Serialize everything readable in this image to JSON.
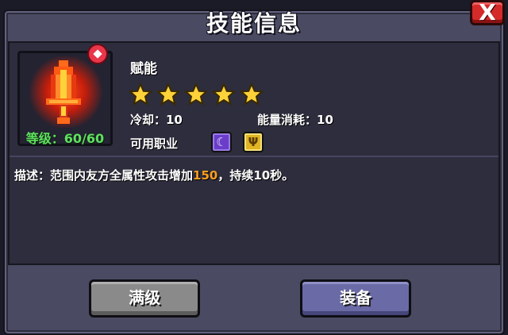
{
  "dialog": {
    "title": "技能信息",
    "close_label": "X"
  },
  "skill": {
    "name": "赋能",
    "icon": "flaming-sword-icon",
    "level_text": "等级：60/60",
    "stars": 5,
    "cooldown_text": "冷却：10",
    "energy_cost_text": "能量消耗：10",
    "classes_label": "可用职业",
    "classes": [
      {
        "icon": "mage-hat-icon",
        "color": "#6b3ec9"
      },
      {
        "icon": "trident-icon",
        "color": "#e0b524"
      }
    ],
    "description_prefix": "描述：范围内友方全属性攻击增加",
    "description_value": "150",
    "description_suffix": "，持续10秒。"
  },
  "buttons": {
    "max_level": "满级",
    "equip": "装备"
  },
  "colors": {
    "level_text": "#5fe05f",
    "highlight": "#ff9f20",
    "close_button": "#d42a2a",
    "equip_button": "#6a6aa6",
    "max_button": "#8a8a8a"
  }
}
